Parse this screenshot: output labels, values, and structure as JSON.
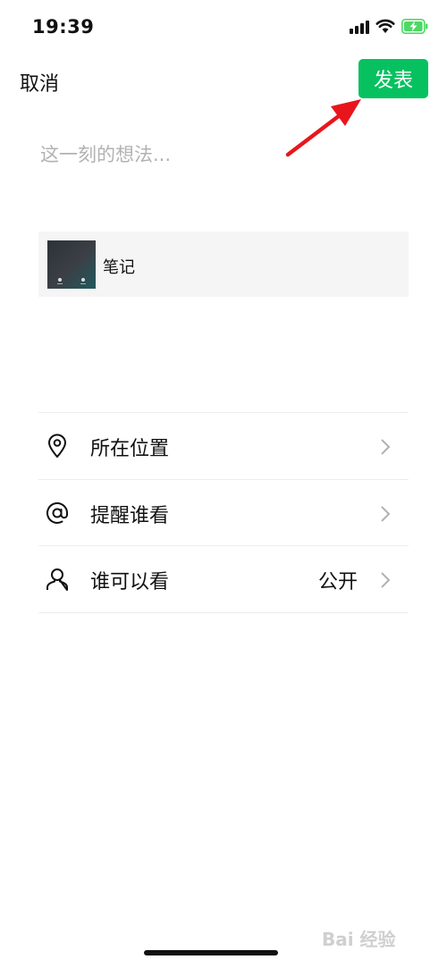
{
  "status_bar": {
    "time": "19:39",
    "battery_color": "#4cd964"
  },
  "header": {
    "cancel_label": "取消",
    "publish_label": "发表",
    "accent_color": "#07c160",
    "annotation_arrow_color": "#e8161c"
  },
  "composer": {
    "placeholder": "这一刻的想法..."
  },
  "attachment": {
    "title": "笔记"
  },
  "settings": [
    {
      "label": "所在位置",
      "icon": "location-pin-icon",
      "value": ""
    },
    {
      "label": "提醒谁看",
      "icon": "at-sign-icon",
      "value": ""
    },
    {
      "label": "谁可以看",
      "icon": "person-icon",
      "value": "公开"
    }
  ],
  "watermark": "Bai 经验"
}
